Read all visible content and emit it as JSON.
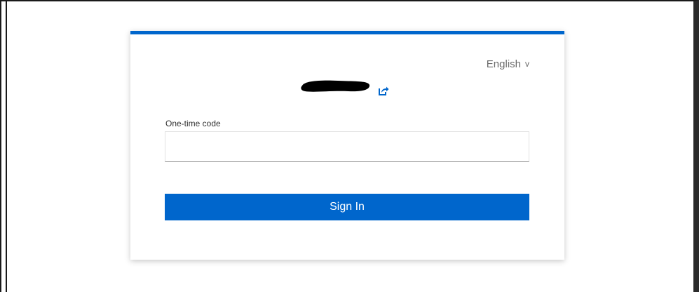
{
  "language_selector": {
    "label": "English",
    "chevron": "v",
    "icon": "chevron-down-icon"
  },
  "identity": {
    "redacted": true,
    "share_icon": "external-link-icon"
  },
  "form": {
    "code_label": "One-time code",
    "code_value": "",
    "code_placeholder": ""
  },
  "actions": {
    "sign_in_label": "Sign In"
  },
  "colors": {
    "accent": "#0066cc",
    "card_background": "#ffffff",
    "muted_text": "#6a6a6a"
  }
}
